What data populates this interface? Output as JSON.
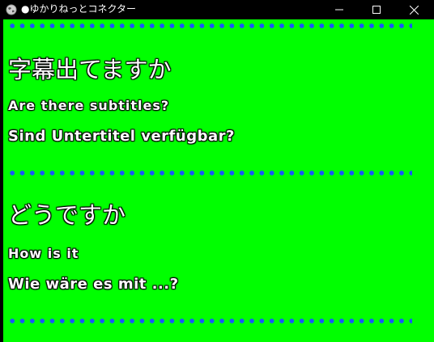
{
  "window": {
    "title": "●ゆかりねっとコネクター"
  },
  "icons": {
    "app": "globe-icon",
    "minimize": "minimize-icon",
    "maximize": "maximize-icon",
    "close": "close-icon"
  },
  "colors": {
    "background": "#00ff00",
    "dots": "#1a55ff",
    "text": "#ffffff",
    "titlebar": "#000000"
  },
  "entries": [
    {
      "japanese": "字幕出てますか",
      "english": "Are there subtitles?",
      "german": "Sind Untertitel verfügbar?"
    },
    {
      "japanese": "どうですか",
      "english": "How is it",
      "german": "Wie wäre es mit ...?"
    }
  ]
}
